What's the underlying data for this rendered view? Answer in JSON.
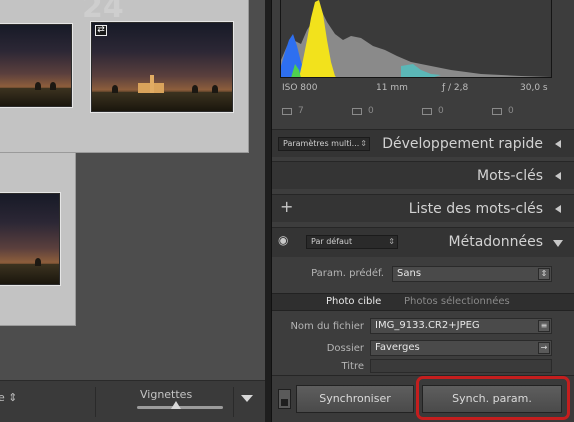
{
  "grid": {
    "cell_index": "24",
    "badge_glyph": "⇄"
  },
  "toolbar": {
    "sort_fragment": "e ⇕",
    "thumbnails_label": "Vignettes",
    "thumbnail_size": 0.45
  },
  "histogram": {
    "iso": "ISO 800",
    "focal": "11 mm",
    "aperture": "ƒ / 2,8",
    "shutter": "30,0 s",
    "crop_count": "7",
    "tool_values": [
      "0",
      "0",
      "0"
    ]
  },
  "panels": {
    "quick_develop": {
      "preset": "Paramètres multi...",
      "title": "Développement rapide"
    },
    "keywording": {
      "title": "Mots-clés"
    },
    "keyword_list": {
      "title": "Liste des mots-clés",
      "add_glyph": "+"
    },
    "metadata": {
      "preset": "Par défaut",
      "title": "Métadonnées"
    }
  },
  "metadata": {
    "preset_label": "Param. prédéf.",
    "preset_value": "Sans",
    "tab_target": "Photo cible",
    "tab_selected": "Photos sélectionnées",
    "filename_label": "Nom du fichier",
    "filename_value": "IMG_9133.CR2+JPEG",
    "folder_label": "Dossier",
    "folder_value": "Faverges",
    "title_label": "Titre"
  },
  "sync": {
    "sync_label": "Synchroniser",
    "sync_settings_label": "Synch. param."
  },
  "colors": {
    "highlight": "#c41e1e",
    "histogram_blue": "#2e6ff0",
    "histogram_yellow": "#f2e21c"
  },
  "icons": {
    "eye": "eye-icon",
    "list": "list-icon",
    "arrow": "arrow-right-icon"
  }
}
